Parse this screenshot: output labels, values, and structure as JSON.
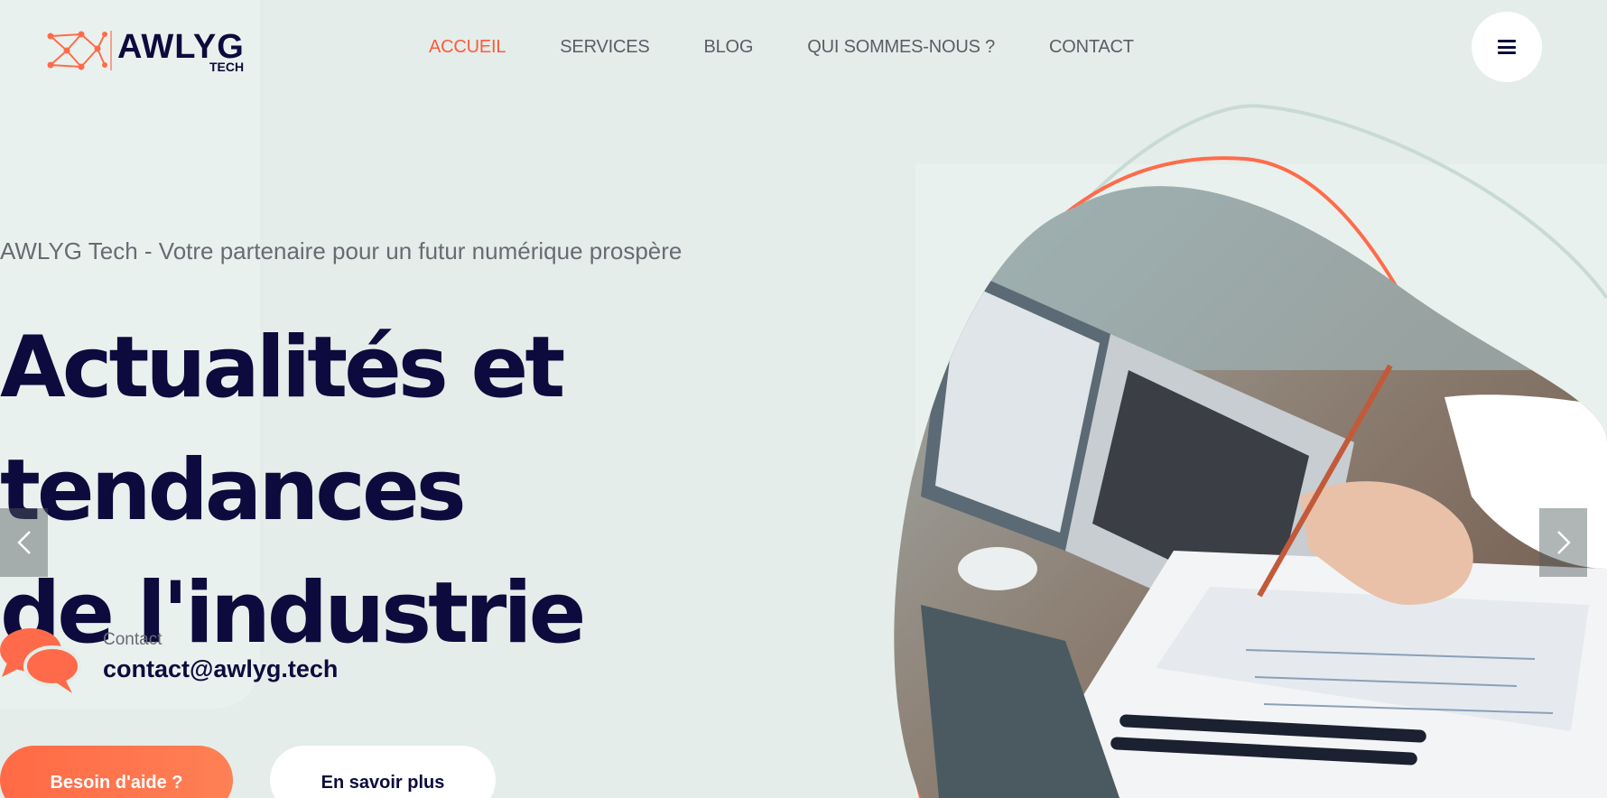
{
  "brand": {
    "name": "AWLYG",
    "sub": "TECH",
    "accent_color": "#ff5a3a",
    "dark_color": "#0d0b3d"
  },
  "nav": {
    "items": [
      {
        "label": "ACCUEIL",
        "active": true
      },
      {
        "label": "SERVICES",
        "active": false
      },
      {
        "label": "BLOG",
        "active": false
      },
      {
        "label": "QUI SOMMES-NOUS ?",
        "active": false
      },
      {
        "label": "CONTACT",
        "active": false
      }
    ],
    "menu_icon": "hamburger-icon"
  },
  "hero": {
    "tagline": "AWLYG Tech - Votre partenaire pour un futur numérique prospère",
    "headline_line1": "Actualités et tendances",
    "headline_line2": "de l'industrie",
    "contact_label": "Contact",
    "contact_email": "contact@awlyg.tech",
    "contact_icon": "chat-bubbles-icon",
    "primary_button": "Besoin d'aide ?",
    "secondary_button": "En savoir plus",
    "image_icon": "laptop-desk-photo"
  },
  "slider": {
    "prev_icon": "chevron-left-icon",
    "next_icon": "chevron-right-icon"
  }
}
